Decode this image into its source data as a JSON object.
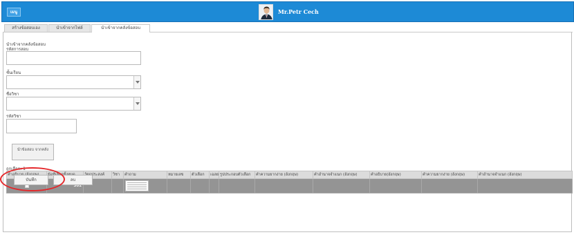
{
  "header": {
    "menu_label": "เมนู",
    "user_name": "Mr.Petr Cech",
    "colors": {
      "bar": "#1d8ad6",
      "text": "#ffffff"
    }
  },
  "tabs": [
    {
      "label": "สร้างข้อสอบเอง",
      "active": false
    },
    {
      "label": "นำเข้าจากไฟล์",
      "active": false
    },
    {
      "label": "นำเข้าจากคลังข้อสอบ",
      "active": true
    }
  ],
  "form": {
    "section_title": "นำเข้าจากคลังข้อสอบ",
    "exam_code_label": "รหัสการสอบ",
    "exam_code_value": "",
    "level_label": "ชั้นเรียน",
    "level_value": "",
    "subject_label": "ชื่อวิชา",
    "subject_value": "",
    "subject_code_label": "รหัสวิชา",
    "subject_code_value": "",
    "import_button": "นำข้อสอบ จากคลัง"
  },
  "grid": {
    "selected_text": "ถูกเลือก: 1",
    "columns": [
      "คำอธิบาย (อังกฤษ)",
      "ข้อที่เลือกทั้งหมด",
      "วัตถุประสงค์",
      "วิชา",
      "คำถาม",
      "หมายเลข",
      "ตัวเลือก",
      "เฉลย",
      "รูปประกอบตัวเลือก",
      "คำความยากง่าย (อังกฤษ)",
      "คำอำนาจจำแนก (อังกฤษ)",
      "คำอธิบาย(อังกฤษ)",
      "คำความยากง่าย (อังกฤษ)",
      "คำอำนาจจำแนก (อังกฤษ)"
    ],
    "rows": [
      {
        "checked": true,
        "count": "301"
      }
    ]
  },
  "actions": {
    "save_label": "บันทึก",
    "delete_label": "ลบ",
    "highlight_color": "#e4282b"
  }
}
